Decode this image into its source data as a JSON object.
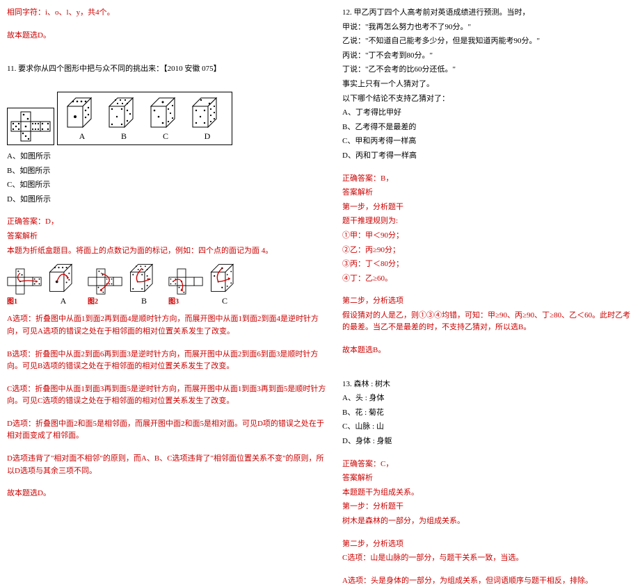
{
  "left": {
    "preface_line1": "相同字符：i、o、l、y，共4个。",
    "preface_answer": "故本题选D。",
    "q11": {
      "title": "11. 要求你从四个图形中把与众不同的挑出来：【2010 安徽 075】",
      "options": [
        "A、如图所示",
        "B、如图所示",
        "C、如图所示",
        "D、如图所示"
      ],
      "labels": [
        "A",
        "B",
        "C",
        "D"
      ],
      "answer_label": "正确答案：D，",
      "analysis_label": "答案解析",
      "analysis_p1": "本题为折纸盒题目。将面上的点数记为面的标记，例如：四个点的面记为面 4。",
      "fig_labels": {
        "f1": "图1",
        "f2": "图2",
        "f3": "图3"
      },
      "expA": "A选项：折叠图中从面1到面2再到面4是顺时针方向，而展开图中从面1到面2到面4是逆时针方向，可见A选项的错误之处在于相邻面的相对位置关系发生了改变。",
      "expB": "B选项：折叠图中从面2到面6再到面3是逆时针方向，而展开图中从面2到面6到面3是顺时针方向。可见B选项的错误之处在于相邻面的相对位置关系发生了改变。",
      "expC": "C选项：折叠图中从面1到面3再到面5是逆时针方向，而展开图中从面1到面3再到面5是顺时针方向。可见C选项的错误之处在于相邻面的相对位置关系发生了改变。",
      "expD": "D选项：折叠图中面2和面5是相邻面，而展开图中面2和面5是相对面。可见D项的错误之处在于相对面变成了相邻面。",
      "expSummary": "D选项违背了\"相对面不相邻\"的原则，而A、B、C选项违背了\"相邻面位置关系不变\"的原则，所以D选项与其余三项不同。",
      "expFinal": "故本题选D。"
    }
  },
  "right": {
    "q12": {
      "stem": [
        "12. 甲乙丙丁四个人高考前对英语成绩进行预测。当时，",
        "甲说：\"我再怎么努力也考不了90分。\"",
        "乙说：\"不知道自己能考多少分，但是我知道丙能考90分。\"",
        "丙说：\"丁不会考到80分。\"",
        "丁说：\"乙不会考的比60分还低。\"",
        "事实上只有一个人猜对了。",
        "以下哪个结论不支持乙猜对了："
      ],
      "options": [
        "A、丁考得比甲好",
        "B、乙考得不是最差的",
        "C、甲和丙考得一样高",
        "D、丙和丁考得一样高"
      ],
      "answer_label": "正确答案：B，",
      "analysis_label": "答案解析",
      "step1_label": "第一步，分析题干",
      "rule_label": "题干推理规则为:",
      "rules": [
        "①甲：甲＜90分；",
        "②乙：丙≥90分；",
        "③丙：丁＜80分；",
        "④丁：乙≥60。"
      ],
      "step2_label": "第二步，分析选项",
      "step2_text": "假设猜对的人是乙，则①③④均错，可知：甲≥90、丙≥90、丁≥80、乙＜60。此时乙考的最差。当乙不是最差的时，不支持乙猜对，所以选B。",
      "final": "故本题选B。"
    },
    "q13": {
      "title": "13. 森林 : 树木",
      "options": [
        "A、头 : 身体",
        "B、花 : 菊花",
        "C、山脉 : 山",
        "D、身体 : 身躯"
      ],
      "answer_label": "正确答案：C，",
      "analysis_label": "答案解析",
      "line1": "本题题干为组成关系。",
      "step1_label": "第一步：分析题干",
      "line2": "树木是森林的一部分，为组成关系。",
      "step2_label": "第二步，分析选项",
      "optC": "C选项：山是山脉的一部分，与题干关系一致，当选。",
      "optA": "A选项：头是身体的一部分，为组成关系，但词语顺序与题干相反，排除。"
    }
  }
}
